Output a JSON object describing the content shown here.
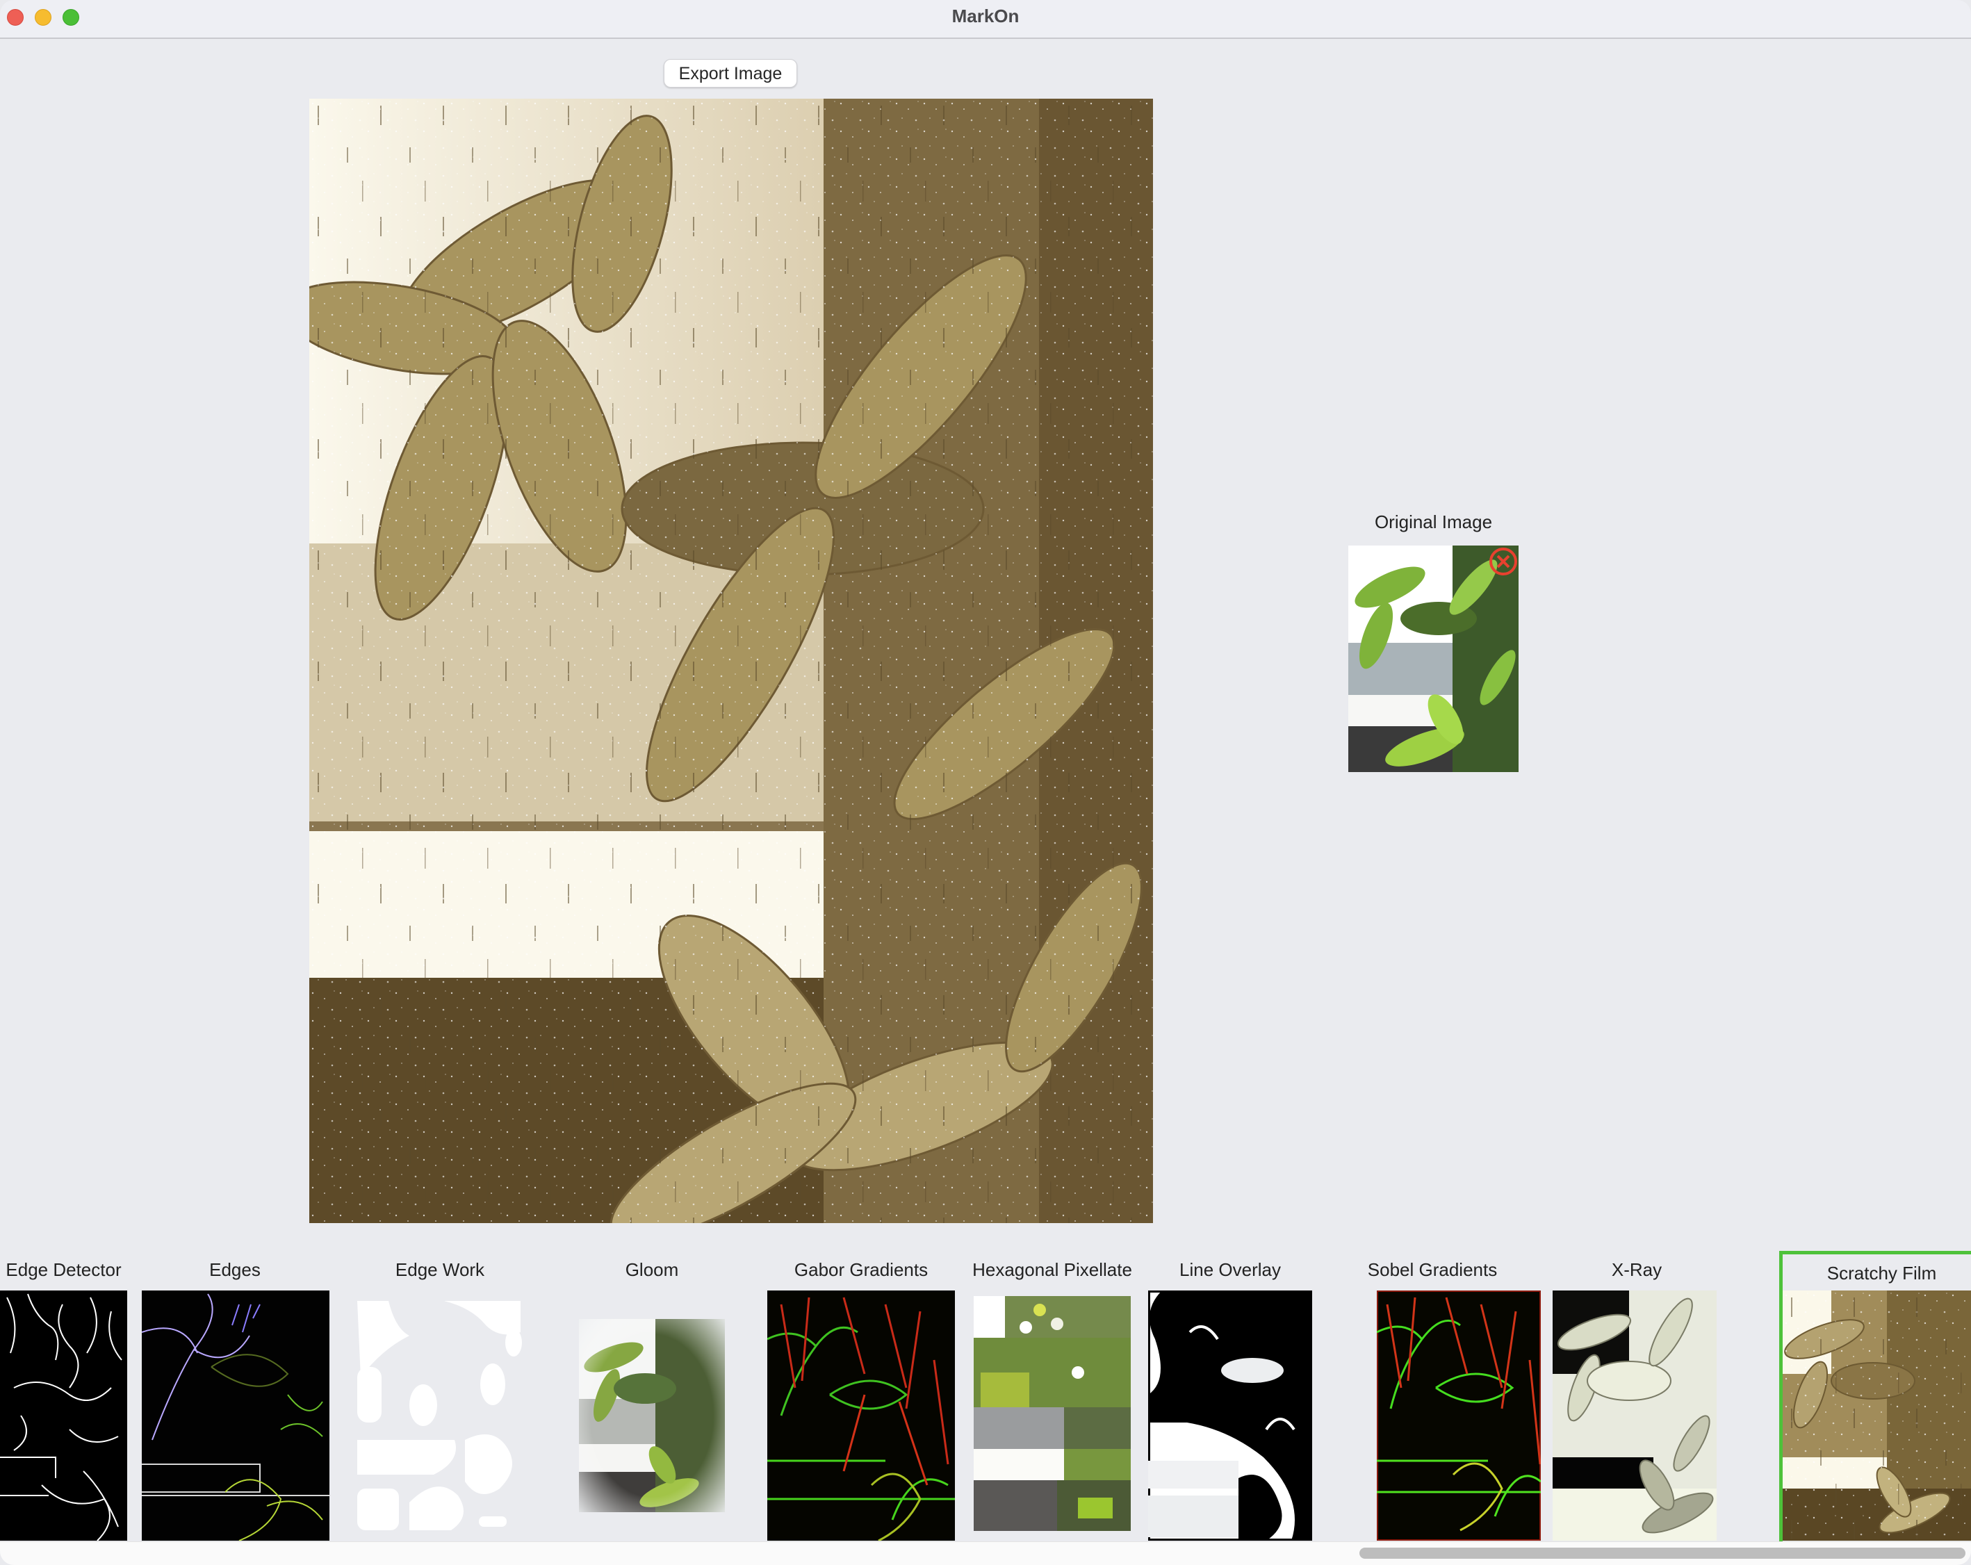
{
  "window": {
    "title": "MarkOn",
    "traffic_lights": [
      "close",
      "minimize",
      "zoom"
    ]
  },
  "toolbar": {
    "export_label": "Export Image"
  },
  "main_preview": {
    "filter_applied": "Scratchy Film",
    "description": "Sepia film-scratch filtered photo of money tree leaves by a window"
  },
  "original": {
    "label": "Original Image",
    "remove_icon": "circle-x-icon"
  },
  "filters": {
    "selected": "Scratchy Film",
    "items": [
      {
        "label": "Edge Detector",
        "style": "edge-detector"
      },
      {
        "label": "Edges",
        "style": "edges"
      },
      {
        "label": "Edge Work",
        "style": "edge-work"
      },
      {
        "label": "Gloom",
        "style": "gloom"
      },
      {
        "label": "Gabor Gradients",
        "style": "gabor"
      },
      {
        "label": "Hexagonal Pixellate",
        "style": "hex"
      },
      {
        "label": "Line Overlay",
        "style": "line-overlay"
      },
      {
        "label": "Sobel Gradients",
        "style": "sobel"
      },
      {
        "label": "X-Ray",
        "style": "xray"
      },
      {
        "label": "Scratchy Film",
        "style": "scratchy",
        "selected": true
      }
    ]
  },
  "colors": {
    "selection_border": "#4ec23a",
    "close_icon": "#e8412f",
    "sepia_light": "#fbf8ea",
    "sepia_dark": "#4e3e20"
  }
}
